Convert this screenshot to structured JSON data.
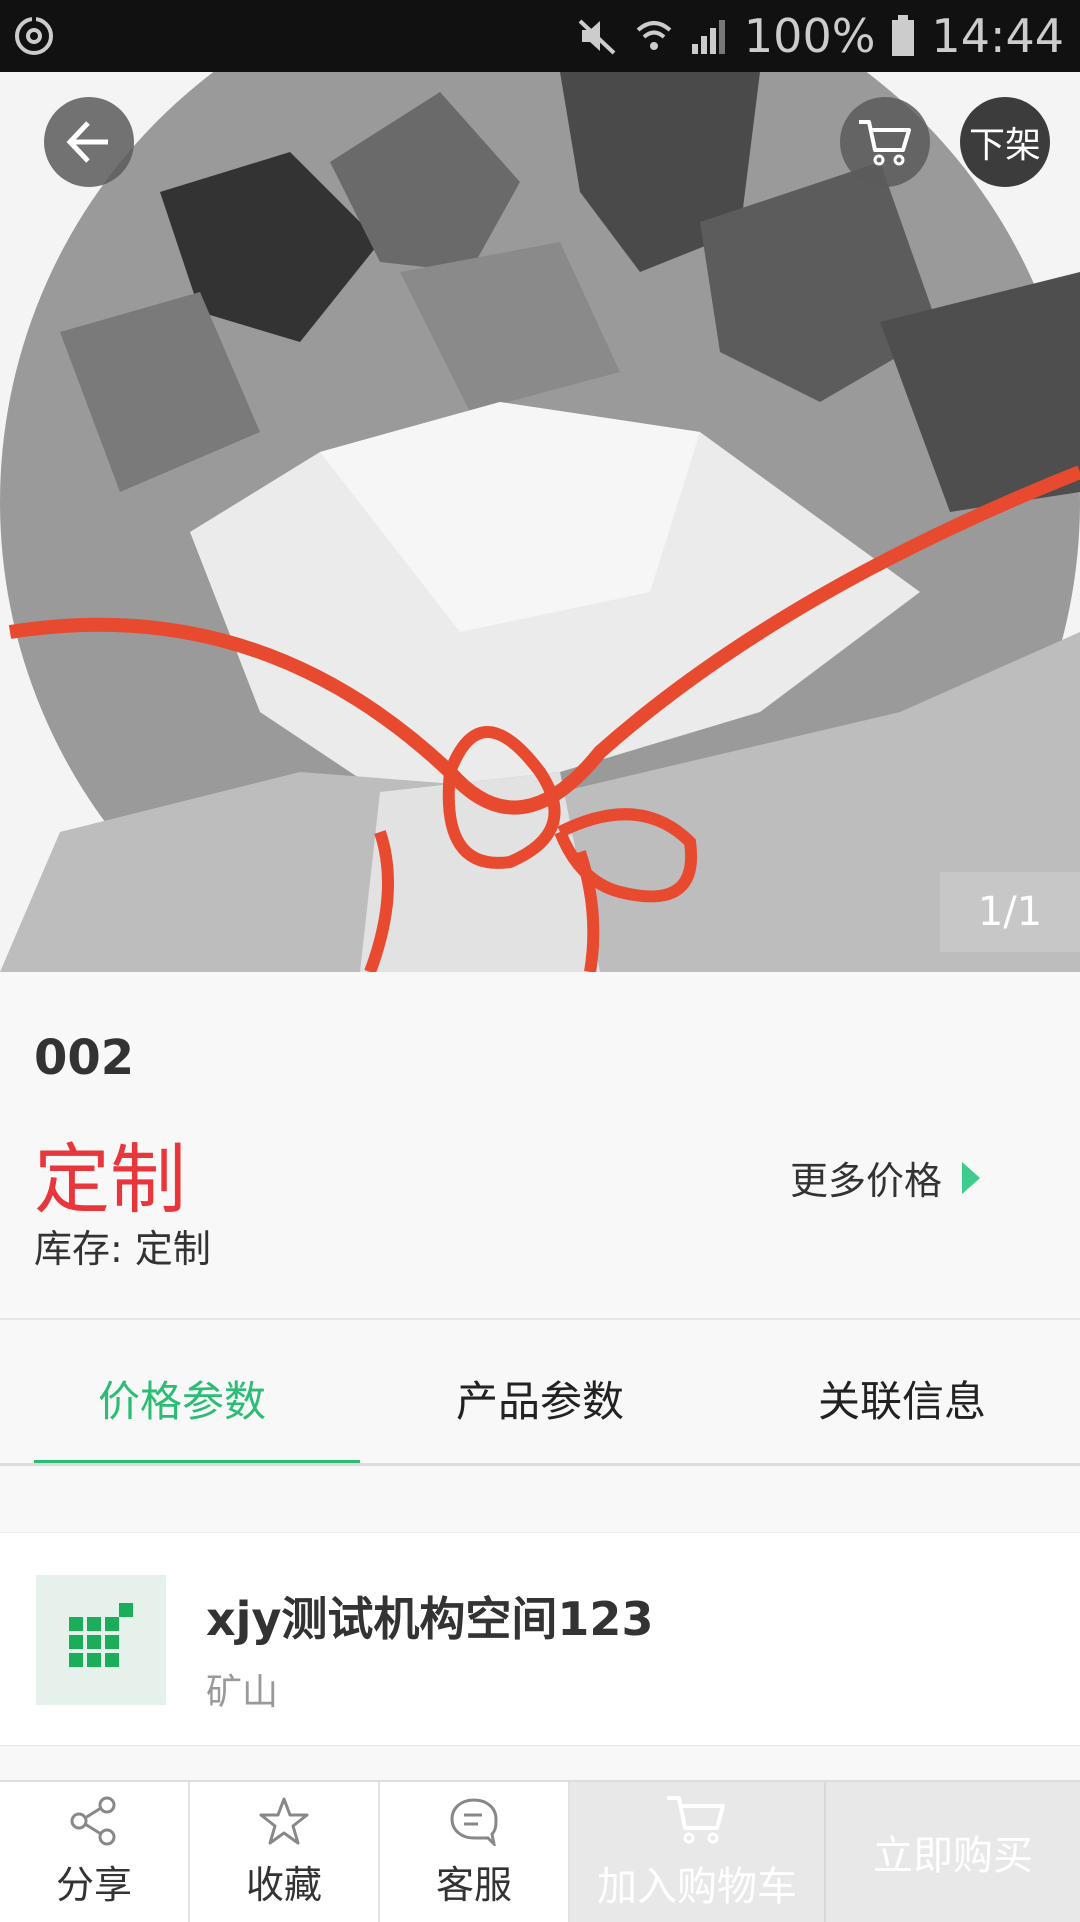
{
  "status_bar": {
    "battery": "100%",
    "time": "14:44"
  },
  "hero": {
    "offline_label": "下架",
    "page_indicator": "1/1"
  },
  "product": {
    "name": "002",
    "price": "定制",
    "more_price": "更多价格",
    "stock": "库存: 定制"
  },
  "tabs": [
    {
      "label": "价格参数",
      "active": true
    },
    {
      "label": "产品参数",
      "active": false
    },
    {
      "label": "关联信息",
      "active": false
    }
  ],
  "org": {
    "name": "xjy测试机构空间123",
    "location": "矿山"
  },
  "bottom_bar": {
    "share": "分享",
    "favorite": "收藏",
    "service": "客服",
    "add_to_cart": "加入购物车",
    "buy_now": "立即购买"
  },
  "colors": {
    "accent_green": "#2bbd74",
    "price_red": "#e8363c",
    "status_bar_bg": "#111111"
  }
}
